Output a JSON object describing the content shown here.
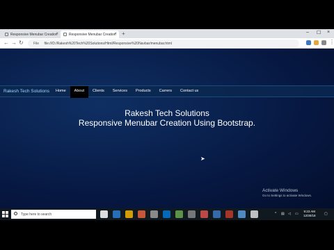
{
  "browser": {
    "tabs": [
      {
        "label": "Responsive Menubar Creation"
      },
      {
        "label": "Responsive Menubar Creation"
      }
    ],
    "new_tab_symbol": "+",
    "close_symbol": "×",
    "window_controls": {
      "minimize": "–",
      "maximize": "☐",
      "close": "×"
    },
    "nav": {
      "back": "←",
      "forward": "→",
      "reload": "↻"
    },
    "address_label": "File",
    "address": "file:///D:/Rakesh%20Tech%20Solutions/Html/Responsive%20Navbar/menubar.html",
    "menu_symbol": "⋮"
  },
  "page": {
    "brand": "Rakesh Tech Solutions",
    "menu": [
      {
        "label": "Home",
        "active": false
      },
      {
        "label": "About",
        "active": true
      },
      {
        "label": "Clients",
        "active": false
      },
      {
        "label": "Services",
        "active": false
      },
      {
        "label": "Products",
        "active": false
      },
      {
        "label": "Carrers",
        "active": false
      },
      {
        "label": "Contact us",
        "active": false
      }
    ],
    "hero_title": "Rakesh Tech Solutions",
    "hero_subtitle": "Responsive Menubar Creation Using Bootstrap.",
    "watermark_title": "Activate Windows",
    "watermark_sub": "Go to Settings to activate Windows."
  },
  "taskbar": {
    "search_placeholder": "Type here to search",
    "time": "9:23 AM",
    "date": "12/30/18",
    "icon_colors": [
      "#ffffff",
      "#2a7fd4",
      "#f4b400",
      "#e8643c",
      "#9e9e9e",
      "#0078d7",
      "#6aa84f",
      "#888888",
      "#d9534f",
      "#3b78c3",
      "#c0392b",
      "#5aa0e0",
      "#dddddd"
    ]
  },
  "colors": {
    "page_bg": "#0a2250",
    "navbar_bg": "#0a2850",
    "brand": "#9fd3ff",
    "active_item_bg": "#000000"
  }
}
